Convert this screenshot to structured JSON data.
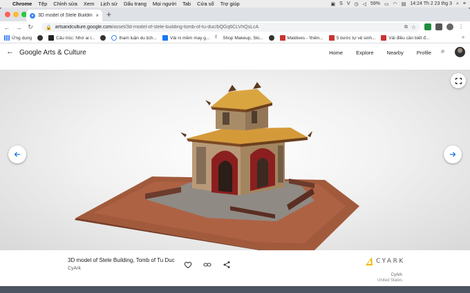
{
  "menubar": {
    "items": [
      "Chrome",
      "Tệp",
      "Chỉnh sửa",
      "Xem",
      "Lịch sử",
      "Dấu trang",
      "Mọi người",
      "Tab",
      "Cửa sổ",
      "Trợ giúp"
    ],
    "battery": "59%",
    "clock": "14:24 Th 2 23 thg 3"
  },
  "browser": {
    "tab_title": "3D model of Stele Building, To",
    "url_host": "artsandculture.google.com",
    "url_path": "/asset/3d-model-of-stele-building-tomb-of-tu-duc/bQGq6CLVhQsLcA",
    "bookmarks": [
      {
        "label": "Ứng dụng",
        "color": "#4285f4"
      },
      {
        "label": "",
        "color": "#333333"
      },
      {
        "label": "Cấu trúc: Nhớ ai l...",
        "color": "#222222"
      },
      {
        "label": "",
        "color": "#333333"
      },
      {
        "label": "tham luận du lịch...",
        "color": "#4285f4"
      },
      {
        "label": "Vải ni mềm may g...",
        "color": "#1877f2"
      },
      {
        "label": "Shop Makeup, Ski...",
        "color": "#555555"
      },
      {
        "label": "",
        "color": "#333333"
      },
      {
        "label": "Maldives - 'thiên...",
        "color": "#cc3333"
      },
      {
        "label": "5 bước tự vệ sinh...",
        "color": "#cc3333"
      },
      {
        "label": "Vải điều cần biết đ...",
        "color": "#cc3333"
      }
    ]
  },
  "site": {
    "brand": "Google Arts & Culture",
    "nav": [
      "Home",
      "Explore",
      "Nearby",
      "Profile"
    ]
  },
  "asset": {
    "title": "3D model of Stele Building, Tomb of Tu Duc",
    "creator": "CyArk",
    "logo_text": "CYARK",
    "org": "CyArk",
    "country": "United States"
  },
  "colors": {
    "accent": "#1a73e8",
    "cyark_yellow": "#f2b705"
  }
}
